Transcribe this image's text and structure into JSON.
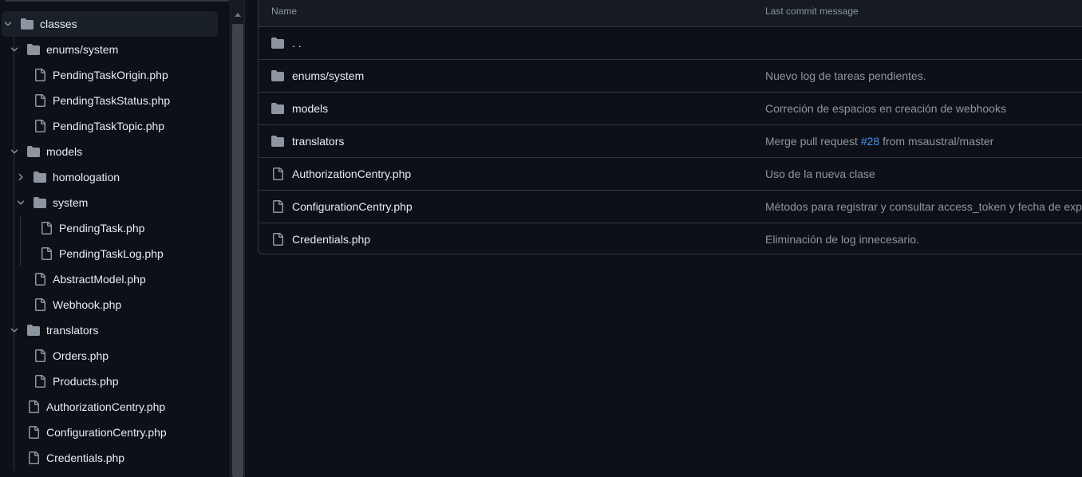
{
  "colors": {
    "background": "#0d1117",
    "folder_icon": "#8d96a0",
    "file_icon": "#8d96a0",
    "text": "#e6edf3",
    "muted_text": "#8d96a0",
    "link": "#4493f8",
    "border": "#30363d"
  },
  "tree": {
    "items": [
      {
        "label": "classes",
        "type": "folder",
        "icon": "folder-icon",
        "expanded": true,
        "selected": true
      },
      {
        "label": "enums/system",
        "type": "folder",
        "icon": "folder-icon",
        "expanded": true
      },
      {
        "label": "PendingTaskOrigin.php",
        "type": "file",
        "icon": "file-icon"
      },
      {
        "label": "PendingTaskStatus.php",
        "type": "file",
        "icon": "file-icon"
      },
      {
        "label": "PendingTaskTopic.php",
        "type": "file",
        "icon": "file-icon"
      },
      {
        "label": "models",
        "type": "folder",
        "icon": "folder-icon",
        "expanded": true
      },
      {
        "label": "homologation",
        "type": "folder",
        "icon": "folder-icon",
        "expanded": false
      },
      {
        "label": "system",
        "type": "folder",
        "icon": "folder-icon",
        "expanded": true
      },
      {
        "label": "PendingTask.php",
        "type": "file",
        "icon": "file-icon"
      },
      {
        "label": "PendingTaskLog.php",
        "type": "file",
        "icon": "file-icon"
      },
      {
        "label": "AbstractModel.php",
        "type": "file",
        "icon": "file-icon"
      },
      {
        "label": "Webhook.php",
        "type": "file",
        "icon": "file-icon"
      },
      {
        "label": "translators",
        "type": "folder",
        "icon": "folder-icon",
        "expanded": true
      },
      {
        "label": "Orders.php",
        "type": "file",
        "icon": "file-icon"
      },
      {
        "label": "Products.php",
        "type": "file",
        "icon": "file-icon"
      },
      {
        "label": "AuthorizationCentry.php",
        "type": "file",
        "icon": "file-icon"
      },
      {
        "label": "ConfigurationCentry.php",
        "type": "file",
        "icon": "file-icon"
      },
      {
        "label": "Credentials.php",
        "type": "file",
        "icon": "file-icon"
      }
    ]
  },
  "table": {
    "headers": {
      "name": "Name",
      "message": "Last commit message"
    },
    "rows": [
      {
        "name": ". .",
        "type": "folder",
        "icon": "folder-icon",
        "message": ""
      },
      {
        "name": "enums/system",
        "type": "folder",
        "icon": "folder-icon",
        "message": "Nuevo log de tareas pendientes."
      },
      {
        "name": "models",
        "type": "folder",
        "icon": "folder-icon",
        "message": "Correción de espacios en creación de webhooks"
      },
      {
        "name": "translators",
        "type": "folder",
        "icon": "folder-icon",
        "message_before": "Merge pull request ",
        "message_link": "#28",
        "message_after": " from msaustral/master"
      },
      {
        "name": "AuthorizationCentry.php",
        "type": "file",
        "icon": "file-icon",
        "message": "Uso de la nueva clase"
      },
      {
        "name": "ConfigurationCentry.php",
        "type": "file",
        "icon": "file-icon",
        "message": "Métodos para registrar y consultar access_token y fecha de expir"
      },
      {
        "name": "Credentials.php",
        "type": "file",
        "icon": "file-icon",
        "message": "Eliminación de log innecesario."
      }
    ]
  }
}
